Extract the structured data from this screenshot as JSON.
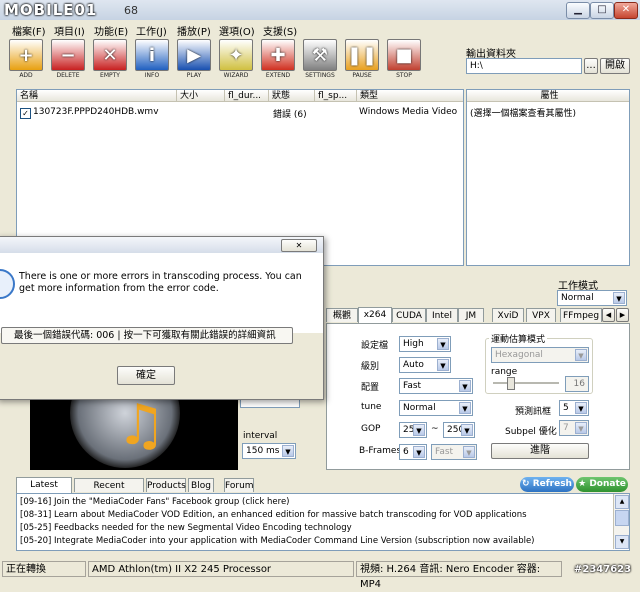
{
  "window": {
    "logo": "MOBILE01",
    "version_fragment": "68"
  },
  "menu": [
    "檔案(F)",
    "項目(I)",
    "功能(E)",
    "工作(J)",
    "播放(P)",
    "選項(O)",
    "支援(S)"
  ],
  "toolbar": [
    {
      "label": "ADD",
      "icon": "add-icon",
      "color": "#e8a010",
      "glyph": "+"
    },
    {
      "label": "DELETE",
      "icon": "delete-icon",
      "color": "#c82020",
      "glyph": "−"
    },
    {
      "label": "EMPTY",
      "icon": "empty-icon",
      "color": "#c82020",
      "glyph": "✕"
    },
    {
      "label": "INFO",
      "icon": "info-icon",
      "color": "#2060c0",
      "glyph": "i"
    },
    {
      "label": "PLAY",
      "icon": "play-icon",
      "color": "#1850b0",
      "glyph": "▶"
    },
    {
      "label": "WIZARD",
      "icon": "wizard-icon",
      "color": "#d0c040",
      "glyph": "✦"
    },
    {
      "label": "EXTEND",
      "icon": "extend-icon",
      "color": "#d03020",
      "glyph": "✚"
    },
    {
      "label": "SETTINGS",
      "icon": "settings-icon",
      "color": "#808080",
      "glyph": "⚒"
    },
    {
      "label": "PAUSE",
      "icon": "pause-icon",
      "color": "#e8a020",
      "glyph": "❚❚"
    },
    {
      "label": "STOP",
      "icon": "stop-icon",
      "color": "#c04030",
      "glyph": "■"
    }
  ],
  "output": {
    "label": "輸出資料夾",
    "path": "H:\\",
    "browse_label": "...",
    "open_label": "開啟"
  },
  "file_list": {
    "columns": [
      "名稱",
      "大小",
      "fl_dur...",
      "狀態",
      "fl_sp...",
      "類型"
    ],
    "rows": [
      {
        "name": "130723F.PPPD240HDB.wmv",
        "size": "",
        "duration": "",
        "status": "錯誤 (6)",
        "speed": "",
        "type": "Windows Media Video",
        "checked": "✓"
      }
    ]
  },
  "properties": {
    "header": "屬性",
    "text": "(選擇一個檔案查看其屬性)"
  },
  "work_mode": {
    "label": "工作模式",
    "value": "Normal"
  },
  "settings_tabs": [
    "概觀",
    "x264",
    "CUDA",
    "Intel",
    "JM",
    "XviD",
    "VPX",
    "FFmpeg"
  ],
  "x264": {
    "profile_label": "設定檔",
    "profile": "High",
    "level_label": "級別",
    "level": "Auto",
    "preset_label": "配置",
    "preset": "Fast",
    "tune_label": "tune",
    "tune": "Normal",
    "gop_label": "GOP",
    "gop_min": "25",
    "gop_sep": "~",
    "gop_max": "250",
    "bframes_label": "B-Frames",
    "bframes": "6",
    "bframes_mode": "Fast",
    "motion_label": "運動估算模式",
    "motion": "Hexagonal",
    "range_label": "range",
    "range_value": "16",
    "lookahead_label": "預測訊框",
    "lookahead": "5",
    "subpel_label": "Subpel 優化",
    "subpel": "7",
    "advanced_label": "進階"
  },
  "preview": {
    "interval_label": "interval",
    "interval": "150 ms"
  },
  "dialog": {
    "close_glyph": "✕",
    "message": "There is one or more errors in transcoding process. You can get more information from the error code.",
    "error_text": "最後一個錯誤代碼: 006 | 按一下可獲取有關此錯誤的詳細資訊",
    "ok_label": "確定"
  },
  "news": {
    "tabs": [
      "Latest News",
      "Recent Updates",
      "Products",
      "Blog",
      "Forum"
    ],
    "refresh_label": "Refresh",
    "donate_label": "Donate",
    "items": [
      "[09-16] Join the \"MediaCoder Fans\" Facebook group (click here)",
      "[08-31] Learn about MediaCoder VOD Edition, an enhanced edition for massive batch transcoding for VOD applications",
      "[05-25] Feedbacks needed for the new Segmental Video Encoding technology",
      "[05-20] Integrate MediaCoder into your application with MediaCoder Command Line Version (subscription now available)"
    ]
  },
  "statusbar": {
    "status": "正在轉換",
    "cpu": "AMD Athlon(tm) II X2 245 Processor",
    "codec": "視頻: H.264  音訊: Nero Encoder  容器: MP4",
    "watermark": "#2347623"
  }
}
